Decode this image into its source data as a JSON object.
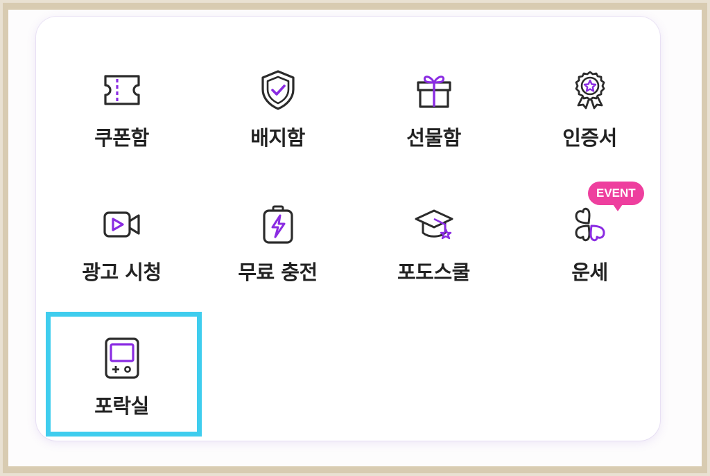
{
  "colors": {
    "accent": "#8a2be2",
    "badge": "#ee3f9e",
    "selection": "#3fcdee",
    "text": "#222222"
  },
  "menu": {
    "items": [
      {
        "label": "쿠폰함",
        "icon": "ticket-icon"
      },
      {
        "label": "배지함",
        "icon": "shield-check-icon"
      },
      {
        "label": "선물함",
        "icon": "gift-icon"
      },
      {
        "label": "인증서",
        "icon": "award-medal-icon"
      },
      {
        "label": "광고 시청",
        "icon": "video-camera-icon"
      },
      {
        "label": "무료 충전",
        "icon": "battery-charge-icon"
      },
      {
        "label": "포도스쿨",
        "icon": "graduation-cap-icon"
      },
      {
        "label": "운세",
        "icon": "clover-icon",
        "badge": "EVENT"
      },
      {
        "label": "포락실",
        "icon": "game-console-icon",
        "selected": true
      }
    ]
  }
}
